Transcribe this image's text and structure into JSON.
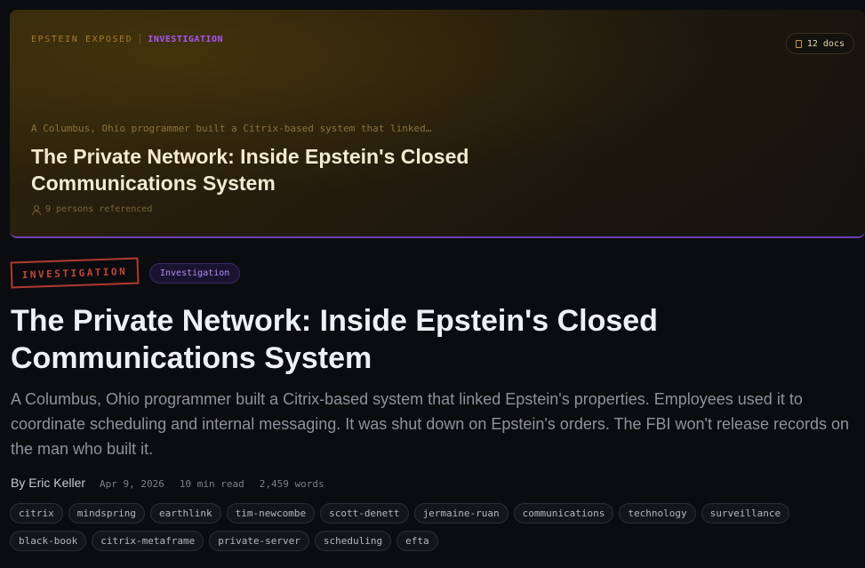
{
  "hero": {
    "brand": "EPSTEIN EXPOSED",
    "kicker": "INVESTIGATION",
    "docs_badge": "12 docs",
    "excerpt": "A Columbus, Ohio programmer built a Citrix-based system that linked…",
    "title": "The Private Network: Inside Epstein's Closed Communications System",
    "persons": "9 persons referenced"
  },
  "article": {
    "stamp": "INVESTIGATION",
    "category": "Investigation",
    "title": "The Private Network: Inside Epstein's Closed Communications System",
    "summary": "A Columbus, Ohio programmer built a Citrix-based system that linked Epstein's properties. Employees used it to coordinate scheduling and internal messaging. It was shut down on Epstein's orders. The FBI won't release records on the man who built it.",
    "author": "By Eric Keller",
    "date": "Apr 9, 2026",
    "read_time": "10 min read",
    "words": "2,459 words"
  },
  "tags": [
    "citrix",
    "mindspring",
    "earthlink",
    "tim-newcombe",
    "scott-denett",
    "jermaine-ruan",
    "communications",
    "technology",
    "surveillance",
    "black-book",
    "citrix-metaframe",
    "private-server",
    "scheduling",
    "efta"
  ],
  "colors": {
    "accent_purple": "#a855f7",
    "stamp_red": "#b03a2e",
    "brand_gold": "#a87a2a",
    "background": "#0b0c10"
  },
  "icons": {
    "docs": "document-icon",
    "persons": "person-icon"
  }
}
